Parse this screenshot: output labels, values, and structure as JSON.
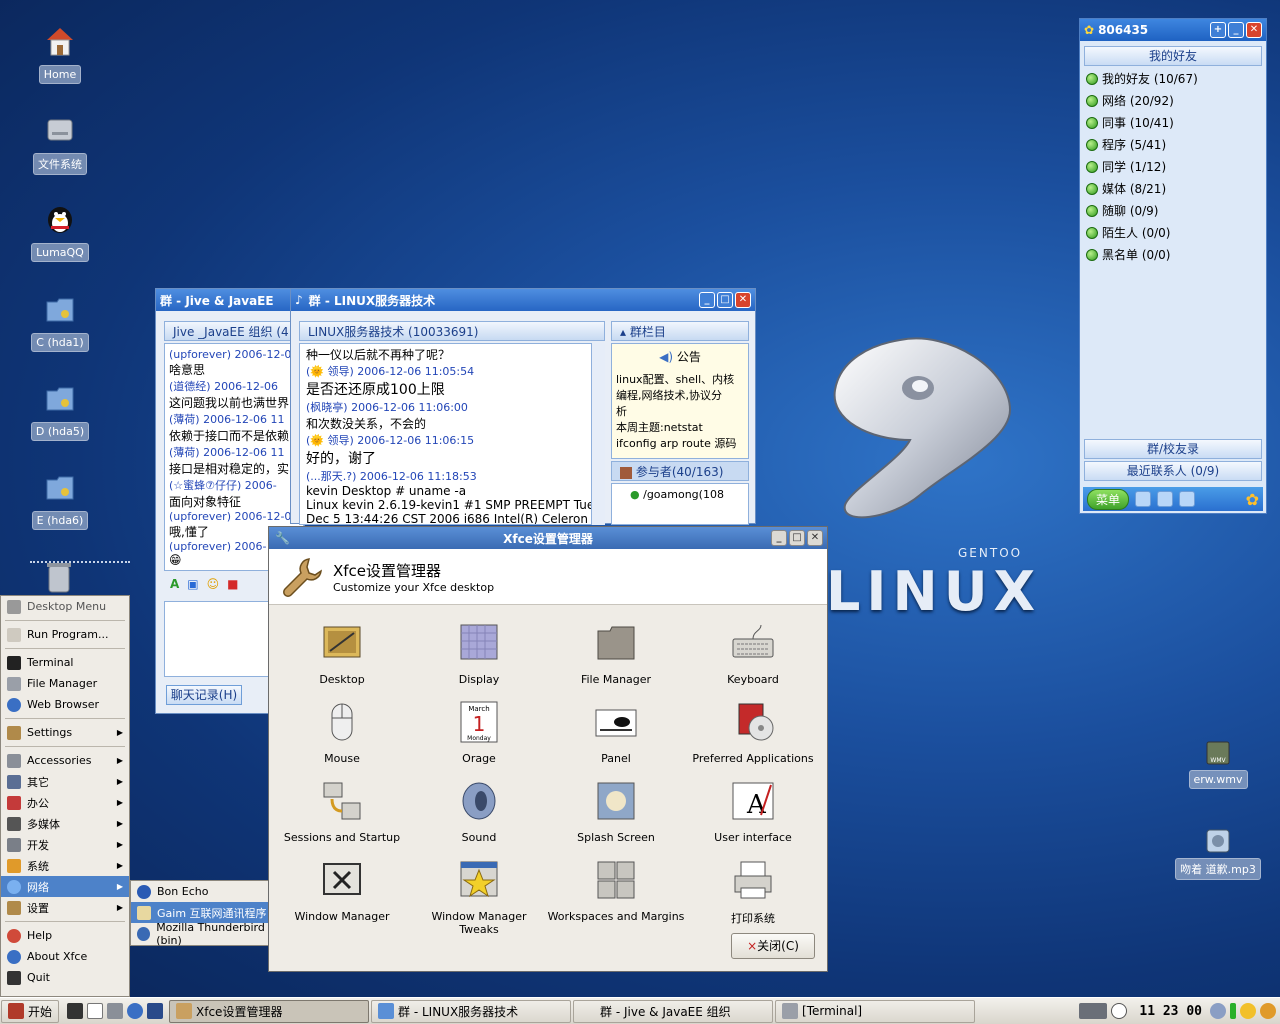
{
  "desktop": {
    "icons": [
      {
        "label": "Home"
      },
      {
        "label": "文件系统"
      },
      {
        "label": "LumaQQ"
      },
      {
        "label": "C (hda1)"
      },
      {
        "label": "D (hda5)"
      },
      {
        "label": "E (hda6)"
      }
    ],
    "right_icons": [
      {
        "label": "erw.wmv",
        "badge": "WMV"
      },
      {
        "label": "吻着 道歉.mp3"
      }
    ],
    "wallpaper": {
      "brand": "GENTOO",
      "word": "LINUX"
    }
  },
  "qq": {
    "title": "806435",
    "header": "我的好友",
    "groups": [
      "我的好友 (10/67)",
      "网络 (20/92)",
      "同事 (10/41)",
      "程序 (5/41)",
      "同学 (1/12)",
      "媒体 (8/21)",
      "随聊 (0/9)",
      "陌生人 (0/0)",
      "黑名单 (0/0)"
    ],
    "school_friends": "群/校友录",
    "recent_contacts": "最近联系人 (0/9)",
    "menu_label": "菜单"
  },
  "chat_back": {
    "title": "群 - Jive & JavaEE",
    "pane_head": "Jive _JavaEE 组织 (4",
    "messages": [
      {
        "who": "(upforever)  2006-12-0",
        "text": "啥意思"
      },
      {
        "who": "(道德经)  2006-12-06",
        "text": "这问题我以前也满世界"
      },
      {
        "who": "(薄荷)  2006-12-06 11",
        "text": "依赖于接口而不是依赖"
      },
      {
        "who": "(薄荷)  2006-12-06 11",
        "text": "接口是相对稳定的，实"
      },
      {
        "who": "(☆蜜蜂⑦仔仔)  2006-",
        "text": "面向对象特征"
      },
      {
        "who": "(upforever)  2006-12-0",
        "text": "哦,懂了"
      },
      {
        "who": "(upforever)  2006-",
        "text": "😁"
      }
    ],
    "history_button": "聊天记录(H)"
  },
  "chat_front": {
    "title": "群 - LINUX服务器技术",
    "pane_head": "LINUX服务器技术 (10033691)",
    "top_cut": "种一仪以后就不再种了呢？",
    "messages": [
      {
        "who": "(🌞 领导)  2006-12-06 11:05:54",
        "text": "是否还还原成100上限"
      },
      {
        "who": "(枫晓亭)  2006-12-06 11:06:00",
        "text": "和次数没关系，不会的"
      },
      {
        "who": "(🌞 领导)  2006-12-06 11:06:15",
        "text": "好的，谢了"
      },
      {
        "who": "(...那天.?)  2006-12-06 11:18:53",
        "text": "kevin Desktop # uname -a"
      }
    ],
    "tail": [
      "Linux kevin 2.6.19-kevin1 #1 SMP PREEMPT Tue",
      "Dec 5 13:44:26 CST 2006 i686 Intel(R) Celeron"
    ],
    "side_head": "群栏目",
    "notice_title": "公告",
    "notice_text": [
      "linux配置、shell、内核",
      "编程,网络技术,协议分",
      "析",
      "本周主题:netstat",
      "ifconfig arp route 源码"
    ],
    "members_label": "参与者(40/163)",
    "member": "/goamong(108"
  },
  "xfce": {
    "title": "Xfce设置管理器",
    "heading": "Xfce设置管理器",
    "subheading": "Customize your Xfce desktop",
    "items": [
      "Desktop",
      "Display",
      "File Manager",
      "Keyboard",
      "Mouse",
      "Orage",
      "Panel",
      "Preferred Applications",
      "Sessions and Startup",
      "Sound",
      "Splash Screen",
      "User interface",
      "Window Manager",
      "Window Manager Tweaks",
      "Workspaces and Margins",
      "打印系统"
    ],
    "orage_month": "March",
    "orage_day": "1",
    "orage_weekday": "Monday",
    "close_button": "关闭(C)"
  },
  "start_menu": {
    "items": [
      {
        "label": "Desktop Menu",
        "type": "header"
      },
      {
        "label": "Run Program...",
        "type": "item"
      },
      {
        "label": "Terminal",
        "type": "item"
      },
      {
        "label": "File Manager",
        "type": "item"
      },
      {
        "label": "Web Browser",
        "type": "item"
      },
      {
        "label": "Settings",
        "type": "sub"
      },
      {
        "label": "Accessories",
        "type": "sub"
      },
      {
        "label": "其它",
        "type": "sub"
      },
      {
        "label": "办公",
        "type": "sub"
      },
      {
        "label": "多媒体",
        "type": "sub"
      },
      {
        "label": "开发",
        "type": "sub"
      },
      {
        "label": "系统",
        "type": "sub"
      },
      {
        "label": "网络",
        "type": "sub-active"
      },
      {
        "label": "设置",
        "type": "sub"
      },
      {
        "label": "Help",
        "type": "item"
      },
      {
        "label": "About Xfce",
        "type": "item"
      },
      {
        "label": "Quit",
        "type": "item"
      }
    ],
    "submenu": [
      "Bon Echo",
      "Gaim 互联网通讯程序",
      "Mozilla Thunderbird (bin)"
    ]
  },
  "taskbar": {
    "start": "开始",
    "tasks": [
      "Xfce设置管理器",
      "群 - LINUX服务器技术",
      "群 - Jive & JavaEE 组织",
      "[Terminal]"
    ],
    "clock": "11 23 00"
  }
}
